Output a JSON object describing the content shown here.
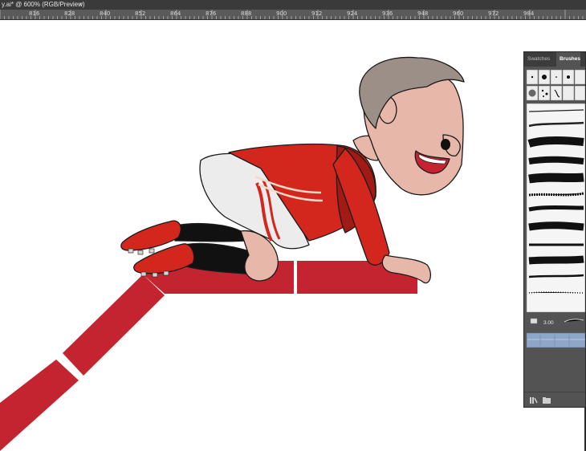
{
  "document": {
    "tab_title": "y.ai* @ 600% (RGB/Preview)",
    "close_glyph": "×"
  },
  "ruler": {
    "labels": [
      "816",
      "828",
      "840",
      "852",
      "864",
      "876",
      "888",
      "900",
      "912",
      "924",
      "936",
      "948",
      "960",
      "972",
      "984"
    ]
  },
  "panel": {
    "tabs": [
      {
        "label": "Swatches",
        "active": false
      },
      {
        "label": "Brushes",
        "active": true
      }
    ],
    "selected_brush_size": "3.00",
    "footer_icons": [
      "brush-libraries-icon",
      "new-folder-icon"
    ]
  },
  "colors": {
    "track_red": "#c4242f",
    "jersey_red": "#d3271e",
    "jersey_dark": "#a11a14",
    "skin": "#e7b8a9",
    "hair": "#9b8f88",
    "shorts": "#ececec",
    "panel_bg": "#535353",
    "ui_dark": "#3a3a3a"
  }
}
